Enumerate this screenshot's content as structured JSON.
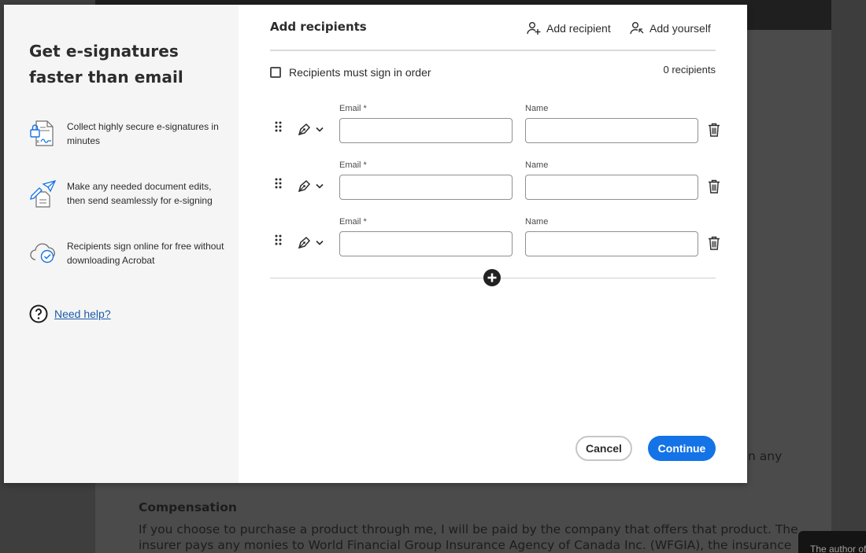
{
  "background": {
    "line1_fragment": "n any",
    "heading": "Compensation",
    "para_line1": "If you choose to purchase a product through me, I will be paid by the company that offers that product. The",
    "para_line2": "insurer pays any monies to World Financial Group Insurance Agency of Canada Inc. (WFGIA), the insurance",
    "tooltip": "The author of"
  },
  "sidebar": {
    "title": "Get e-signatures faster than email",
    "features": [
      {
        "icon": "secure-document-icon",
        "text": "Collect highly secure e-signatures in minutes"
      },
      {
        "icon": "edit-send-icon",
        "text": "Make any needed document edits, then send seamlessly for e-signing"
      },
      {
        "icon": "cloud-check-icon",
        "text": "Recipients sign online for free without downloading Acrobat"
      }
    ],
    "help_label": "Need help?"
  },
  "main": {
    "title": "Add recipients",
    "add_recipient_label": "Add recipient",
    "add_yourself_label": "Add yourself",
    "sign_in_order_label": "Recipients must sign in order",
    "sign_in_order_checked": false,
    "recipient_count": "0 recipients",
    "email_label": "Email *",
    "name_label": "Name",
    "recipients": [
      {
        "email": "",
        "name": "",
        "role_icon": "pen-signer-icon"
      },
      {
        "email": "",
        "name": "",
        "role_icon": "pen-signer-icon"
      },
      {
        "email": "",
        "name": "",
        "role_icon": "pen-signer-icon"
      }
    ],
    "cancel_label": "Cancel",
    "continue_label": "Continue"
  },
  "colors": {
    "accent": "#1473e6",
    "link": "#1c5aa8",
    "sidebar_bg": "#f5f5f5"
  }
}
